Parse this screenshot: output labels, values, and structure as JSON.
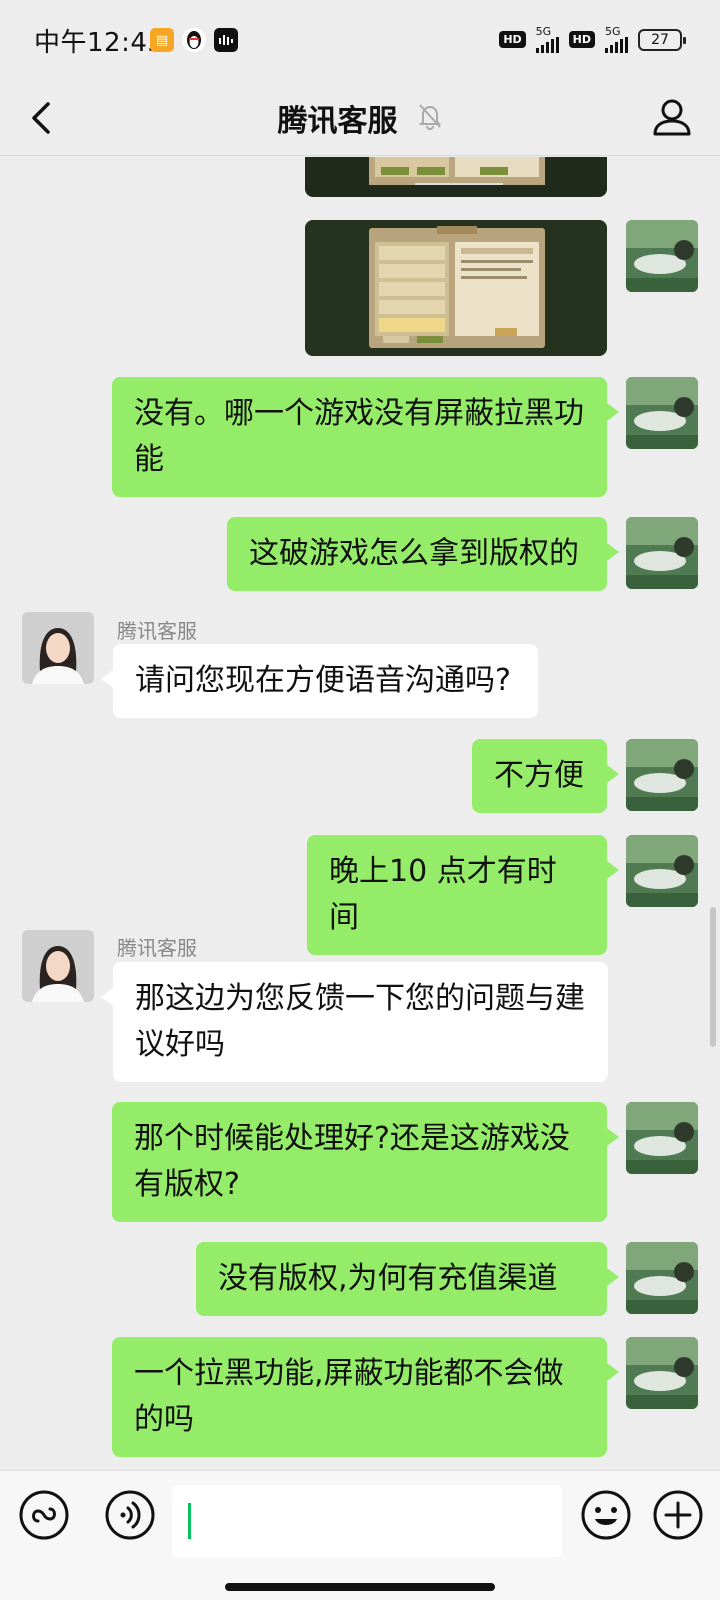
{
  "status_bar": {
    "time": "中午12:45",
    "battery": "27",
    "network_1": "5G",
    "network_2": "5G",
    "hd_1": "HD",
    "hd_2": "HD"
  },
  "header": {
    "title": "腾讯客服"
  },
  "messages": {
    "m1": "没有。哪一个游戏没有屏蔽拉黑功能",
    "m2": "这破游戏怎么拿到版权的",
    "m3_sender": "腾讯客服",
    "m3": "请问您现在方便语音沟通吗?",
    "m4": "不方便",
    "m5": "晚上10 点才有时间",
    "m6_sender": "腾讯客服",
    "m6": "那这边为您反馈一下您的问题与建议好吗",
    "m7": "那个时候能处理好?还是这游戏没有版权?",
    "m8": "没有版权,为何有充值渠道",
    "m9": "一个拉黑功能,屏蔽功能都不会做的吗"
  },
  "input": {
    "value": "",
    "placeholder": ""
  },
  "icons": {
    "back": "chevron-left-icon",
    "mute": "bell-off-icon",
    "profile": "person-icon",
    "mini_program": "link-icon",
    "voice": "voice-icon",
    "emoji": "emoji-icon",
    "plus": "plus-icon"
  },
  "colors": {
    "my_bubble": "#95ec69",
    "their_bubble": "#ffffff",
    "background": "#ededed",
    "cursor": "#07c160"
  }
}
